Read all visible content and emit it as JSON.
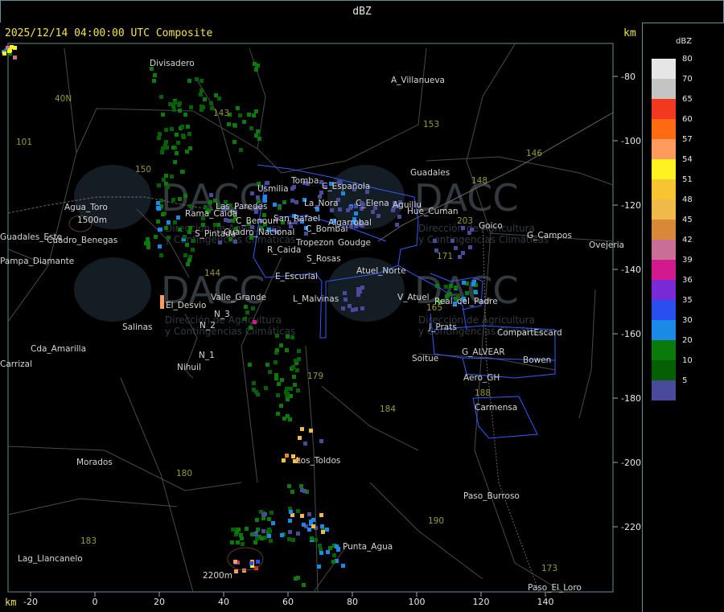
{
  "header": {
    "title": "dBZ"
  },
  "status": {
    "timestamp": "2025/12/14 04:00:00 UTC Composite",
    "unit_top": "km",
    "unit_bottom": "km"
  },
  "legend": {
    "unit": "dBZ",
    "items": [
      {
        "value": "80",
        "color": "#e6e6e6"
      },
      {
        "value": "70",
        "color": "#c4c4c4"
      },
      {
        "value": "65",
        "color": "#f2391f"
      },
      {
        "value": "60",
        "color": "#ff6a12"
      },
      {
        "value": "57",
        "color": "#ff9b5c"
      },
      {
        "value": "54",
        "color": "#fff221"
      },
      {
        "value": "51",
        "color": "#f7c531"
      },
      {
        "value": "48",
        "color": "#f0ba4a"
      },
      {
        "value": "45",
        "color": "#d98739"
      },
      {
        "value": "42",
        "color": "#c96f96"
      },
      {
        "value": "39",
        "color": "#d21a8e"
      },
      {
        "value": "36",
        "color": "#7a2ad4"
      },
      {
        "value": "35",
        "color": "#2a4ff0"
      },
      {
        "value": "30",
        "color": "#1a8ae6"
      },
      {
        "value": "20",
        "color": "#0a7a0a"
      },
      {
        "value": "10",
        "color": "#055f05"
      },
      {
        "value": "5",
        "color": "#4a4a9a"
      }
    ]
  },
  "axes": {
    "x_ticks": [
      "-20",
      "0",
      "20",
      "40",
      "60",
      "80",
      "100",
      "120",
      "140"
    ],
    "y_ticks": [
      "-80",
      "-100",
      "-120",
      "-140",
      "-160",
      "-180",
      "-200",
      "-220"
    ]
  },
  "places": [
    {
      "name": "Divisadero"
    },
    {
      "name": "A_Villanueva"
    },
    {
      "name": "Guadales"
    },
    {
      "name": "Tomba"
    },
    {
      "name": "Usmilia"
    },
    {
      "name": "C_Española"
    },
    {
      "name": "La_Nora"
    },
    {
      "name": "C_Elena"
    },
    {
      "name": "Aguillu"
    },
    {
      "name": "Hue_Cuman"
    },
    {
      "name": "Rama_Caida"
    },
    {
      "name": "Las_Paredes"
    },
    {
      "name": "San_Rafael"
    },
    {
      "name": "C_Benoun"
    },
    {
      "name": "Algarrobal"
    },
    {
      "name": "Goudge"
    },
    {
      "name": "C_Bombal"
    },
    {
      "name": "Tropezon"
    },
    {
      "name": "R_Caida"
    },
    {
      "name": "S_Rosas"
    },
    {
      "name": "Cuadro_Nacional"
    },
    {
      "name": "Atuel_Norte"
    },
    {
      "name": "E_Escurial"
    },
    {
      "name": "Valle_Grande"
    },
    {
      "name": "L_Malvinas"
    },
    {
      "name": "V_Atuel"
    },
    {
      "name": "S_Pintada"
    },
    {
      "name": "El_Desvio"
    },
    {
      "name": "Salinas"
    },
    {
      "name": "N_2"
    },
    {
      "name": "N_3"
    },
    {
      "name": "N_1"
    },
    {
      "name": "Nihuil"
    },
    {
      "name": "J_Prats"
    },
    {
      "name": "CompartEscard"
    },
    {
      "name": "G_ALVEAR"
    },
    {
      "name": "Soitue"
    },
    {
      "name": "Bowen"
    },
    {
      "name": "Aero_GH"
    },
    {
      "name": "Carmensa"
    },
    {
      "name": "Los_Toldos"
    },
    {
      "name": "Morados"
    },
    {
      "name": "Paso_Burroso"
    },
    {
      "name": "Punta_Agua"
    },
    {
      "name": "Lag_Llancanelo"
    },
    {
      "name": "Paso_El_Loro"
    },
    {
      "name": "Agua_Toro"
    },
    {
      "name": "Pampa_Diamante"
    },
    {
      "name": "Cda_Amarilla"
    },
    {
      "name": "Cuadro_Benegas"
    },
    {
      "name": "Goico"
    },
    {
      "name": "G_Campos"
    },
    {
      "name": "Real_del_Padre"
    },
    {
      "name": "Guadales_Este"
    },
    {
      "name": "Carrizal"
    },
    {
      "name": "Ovejeria"
    }
  ],
  "roads": [
    "40N",
    "101",
    "143",
    "150",
    "153",
    "146",
    "148",
    "203",
    "171",
    "165",
    "179",
    "184",
    "180",
    "190",
    "183",
    "144",
    "173",
    "188"
  ],
  "elevations": [
    "1500m",
    "2200m"
  ],
  "watermark": {
    "brand": "DACC",
    "line1": "Dirección de Agricultura",
    "line2": "y Contingencias Climáticas",
    "url": "http://www.contingencias.mendoza.gov.ar"
  }
}
